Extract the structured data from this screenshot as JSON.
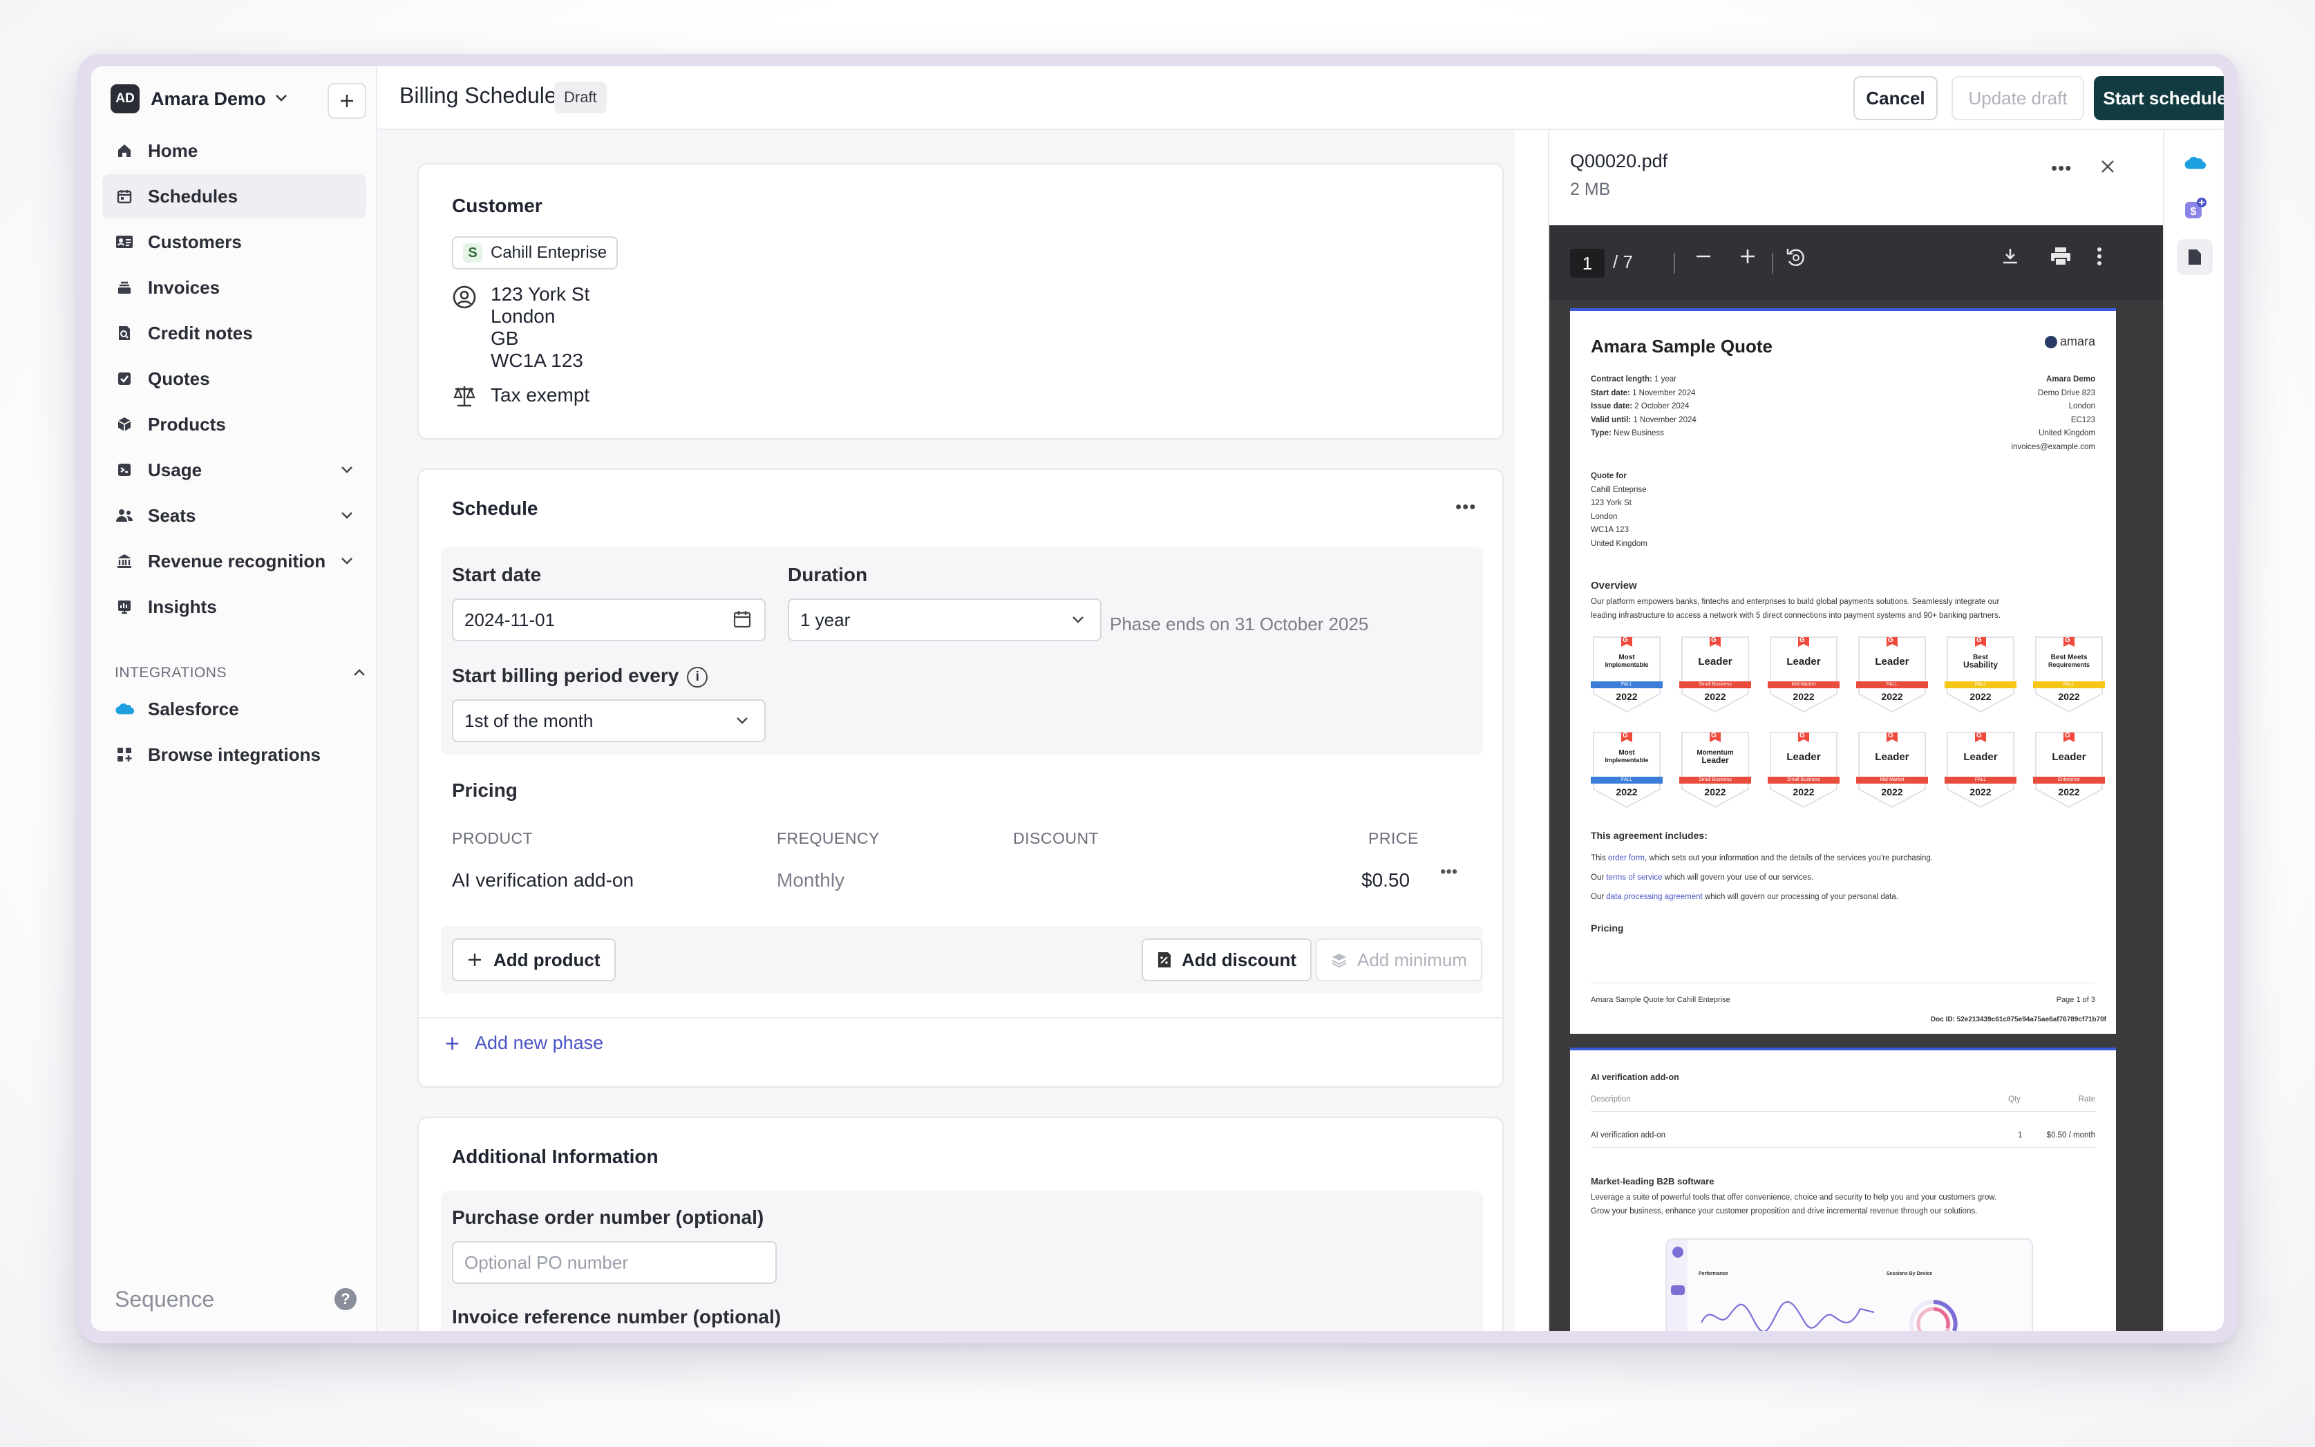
{
  "org": {
    "initials": "AD",
    "name": "Amara Demo"
  },
  "nav": [
    {
      "label": "Home",
      "icon": "home-icon"
    },
    {
      "label": "Schedules",
      "icon": "calendar-icon",
      "active": true
    },
    {
      "label": "Customers",
      "icon": "id-card-icon"
    },
    {
      "label": "Invoices",
      "icon": "invoice-stack-icon"
    },
    {
      "label": "Credit notes",
      "icon": "credit-note-icon"
    },
    {
      "label": "Quotes",
      "icon": "quote-check-icon"
    },
    {
      "label": "Products",
      "icon": "box-icon"
    },
    {
      "label": "Usage",
      "icon": "usage-icon",
      "expandable": true
    },
    {
      "label": "Seats",
      "icon": "users-icon",
      "expandable": true
    },
    {
      "label": "Revenue recognition",
      "icon": "bank-icon",
      "expandable": true
    },
    {
      "label": "Insights",
      "icon": "chart-icon"
    }
  ],
  "integrations": {
    "heading": "INTEGRATIONS",
    "items": [
      {
        "label": "Salesforce",
        "icon": "salesforce-icon"
      },
      {
        "label": "Browse integrations",
        "icon": "grid-plus-icon"
      }
    ]
  },
  "brand": "Sequence",
  "header": {
    "title": "Billing Schedule",
    "status": "Draft",
    "cancel": "Cancel",
    "update": "Update draft",
    "start": "Start schedule"
  },
  "customer": {
    "title": "Customer",
    "chip_initial": "S",
    "name": "Cahill Enteprise",
    "address": [
      "123 York St",
      "London",
      "GB",
      "WC1A 123"
    ],
    "tax": "Tax exempt"
  },
  "schedule": {
    "title": "Schedule",
    "start_label": "Start date",
    "start_value": "2024-11-01",
    "duration_label": "Duration",
    "duration_value": "1 year",
    "phase_note": "Phase ends on 31 October 2025",
    "billing_label": "Start billing period every",
    "billing_value": "1st of the month",
    "pricing_title": "Pricing",
    "columns": {
      "product": "PRODUCT",
      "frequency": "FREQUENCY",
      "discount": "DISCOUNT",
      "price": "PRICE"
    },
    "rows": [
      {
        "product": "AI verification add-on",
        "frequency": "Monthly",
        "discount": "",
        "price": "$0.50"
      }
    ],
    "add_product": "Add product",
    "add_discount": "Add discount",
    "add_minimum": "Add minimum",
    "add_phase": "Add new phase"
  },
  "additional": {
    "title": "Additional Information",
    "po_label": "Purchase order number (optional)",
    "po_placeholder": "Optional PO number",
    "inv_label": "Invoice reference number (optional)"
  },
  "pdf": {
    "filename": "Q00020.pdf",
    "size": "2 MB",
    "page": "1",
    "page_total": "/ 7",
    "page1": {
      "title": "Amara Sample Quote",
      "logo": "amara",
      "meta": [
        {
          "k": "Contract length:",
          "v": "1 year"
        },
        {
          "k": "Start date:",
          "v": "1 November 2024"
        },
        {
          "k": "Issue date:",
          "v": "2 October 2024"
        },
        {
          "k": "Valid until:",
          "v": "1 November 2024"
        },
        {
          "k": "Type:",
          "v": "New Business"
        }
      ],
      "from": [
        "Amara Demo",
        "Demo Drive 823",
        "London",
        "EC123",
        "United Kingdom",
        "invoices@example.com"
      ],
      "quote_for_label": "Quote for",
      "quote_for": [
        "Cahill Enteprise",
        "123 York St",
        "London",
        "WC1A 123",
        "United Kingdom"
      ],
      "overview_title": "Overview",
      "overview_text": [
        "Our platform empowers banks, fintechs and enterprises to build global payments solutions. Seamlessly integrate our",
        "leading infrastructure to access a network with 5 direct connections into payment systems and 90+ banking partners."
      ],
      "badges_row1": [
        {
          "top": "Most",
          "name": "Implementable",
          "ribbon": "FALL",
          "year": "2022",
          "color": "#3b7dd8"
        },
        {
          "top": "",
          "name": "Leader",
          "ribbon": "Small Business",
          "year": "2022",
          "color": "#e74c3c"
        },
        {
          "top": "",
          "name": "Leader",
          "ribbon": "Mid-Market",
          "year": "2022",
          "color": "#e74c3c"
        },
        {
          "top": "",
          "name": "Leader",
          "ribbon": "FALL",
          "year": "2022",
          "color": "#e74c3c"
        },
        {
          "top": "Best",
          "name": "Usability",
          "ribbon": "FALL",
          "year": "2022",
          "color": "#f5c518"
        },
        {
          "top": "Best Meets",
          "name": "Requirements",
          "ribbon": "FALL",
          "year": "2022",
          "color": "#f5c518"
        }
      ],
      "badges_row2": [
        {
          "top": "Most",
          "name": "Implementable",
          "ribbon": "FALL",
          "year": "2022",
          "color": "#3b7dd8"
        },
        {
          "top": "Momentum",
          "name": "Leader",
          "ribbon": "Small Business",
          "year": "2022",
          "color": "#e74c3c"
        },
        {
          "top": "",
          "name": "Leader",
          "ribbon": "Small Business",
          "year": "2022",
          "color": "#e74c3c"
        },
        {
          "top": "",
          "name": "Leader",
          "ribbon": "Mid-Market",
          "year": "2022",
          "color": "#e74c3c"
        },
        {
          "top": "",
          "name": "Leader",
          "ribbon": "FALL",
          "year": "2022",
          "color": "#e74c3c"
        },
        {
          "top": "",
          "name": "Leader",
          "ribbon": "Enterprise",
          "year": "2022",
          "color": "#e74c3c"
        }
      ],
      "agreement_title": "This agreement includes:",
      "agreement": [
        {
          "pre": "This ",
          "link": "order form",
          "post": ", which sets out your information and the details of the services you're purchasing."
        },
        {
          "pre": "Our ",
          "link": "terms of service",
          "post": " which will govern your use of our services."
        },
        {
          "pre": "Our ",
          "link": "data processing agreement",
          "post": " which will govern our processing of your personal data."
        }
      ],
      "pricing_title": "Pricing",
      "footer_left": "Amara Sample Quote for Cahill Enteprise",
      "footer_right": "Page 1 of 3",
      "doc_id": "Doc ID: 52e213439c61c875e94a75ae6af76789cf71b70f"
    },
    "page2": {
      "section_title": "AI verification add-on",
      "col_desc": "Description",
      "col_qty": "Qty",
      "col_rate": "Rate",
      "row_desc": "AI verification add-on",
      "row_qty": "1",
      "row_rate": "$0.50 / month",
      "b2b_title": "Market-leading B2B software",
      "b2b_text": [
        "Leverage a suite of powerful tools that offer convenience, choice and security to help you and your customers grow.",
        "Grow your business, enhance your customer proposition and drive incremental revenue through our solutions."
      ],
      "shot_perf": "Performance",
      "shot_sessions": "Sessions By Device"
    }
  },
  "colors": {
    "accent": "#4953c4",
    "primary_button": "#123b40",
    "pdf_accent": "#3b5bdb"
  }
}
